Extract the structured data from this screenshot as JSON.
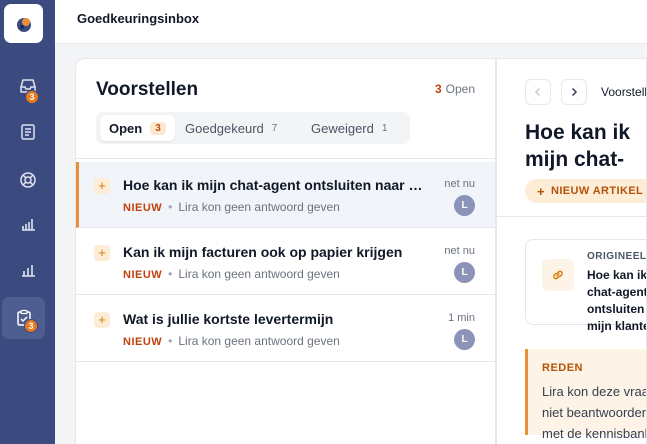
{
  "app": {
    "title": "Goedkeuringsinbox"
  },
  "sidebar": {
    "items": [
      {
        "icon": "inbox-icon",
        "badge": "3"
      },
      {
        "icon": "notebook-icon",
        "badge": ""
      },
      {
        "icon": "lifebuoy-icon",
        "badge": ""
      },
      {
        "icon": "bar-chart-icon",
        "badge": ""
      },
      {
        "icon": "bar-chart-icon",
        "badge": ""
      },
      {
        "icon": "clipboard-check-icon",
        "badge": "3"
      }
    ]
  },
  "list": {
    "title": "Voorstellen",
    "open_count": "3",
    "open_label": "Open",
    "tabs": [
      {
        "label": "Open",
        "count": "3"
      },
      {
        "label": "Goedgekeurd",
        "count": "7"
      },
      {
        "label": "Geweigerd",
        "count": "1"
      }
    ],
    "rows": [
      {
        "title": "Hoe kan ik mijn chat-agent ontsluiten naar mijn klanten",
        "status": "NIEUW",
        "description": "Lira kon geen antwoord geven",
        "time": "net nu",
        "avatar": "L"
      },
      {
        "title": "Kan ik mijn facturen ook op papier krijgen",
        "status": "NIEUW",
        "description": "Lira kon geen antwoord geven",
        "time": "net nu",
        "avatar": "L"
      },
      {
        "title": "Wat is jullie kortste levertermijn",
        "status": "NIEUW",
        "description": "Lira kon geen antwoord geven",
        "time": "1 min",
        "avatar": "L"
      }
    ]
  },
  "detail": {
    "breadcrumb": "Voorstellen",
    "title": "Hoe kan ik mijn chat-agent ontsluiten naar mijn klanten",
    "title_visible": "Hoe kan ik m… naar mijn…",
    "badge": "NIEUW ARTIKEL",
    "original_label": "ORIGINEEL",
    "original_text": "Hoe kan ik mijn chat-agent ontsluiten naar mijn klanten",
    "reason_label": "REDEN",
    "reason_text": "Lira kon deze vraag niet beantwoorden met de kennisbank."
  },
  "colors": {
    "sidebar": "#3b4a7f",
    "accent": "#e8913a",
    "badge": "#e8791c"
  }
}
